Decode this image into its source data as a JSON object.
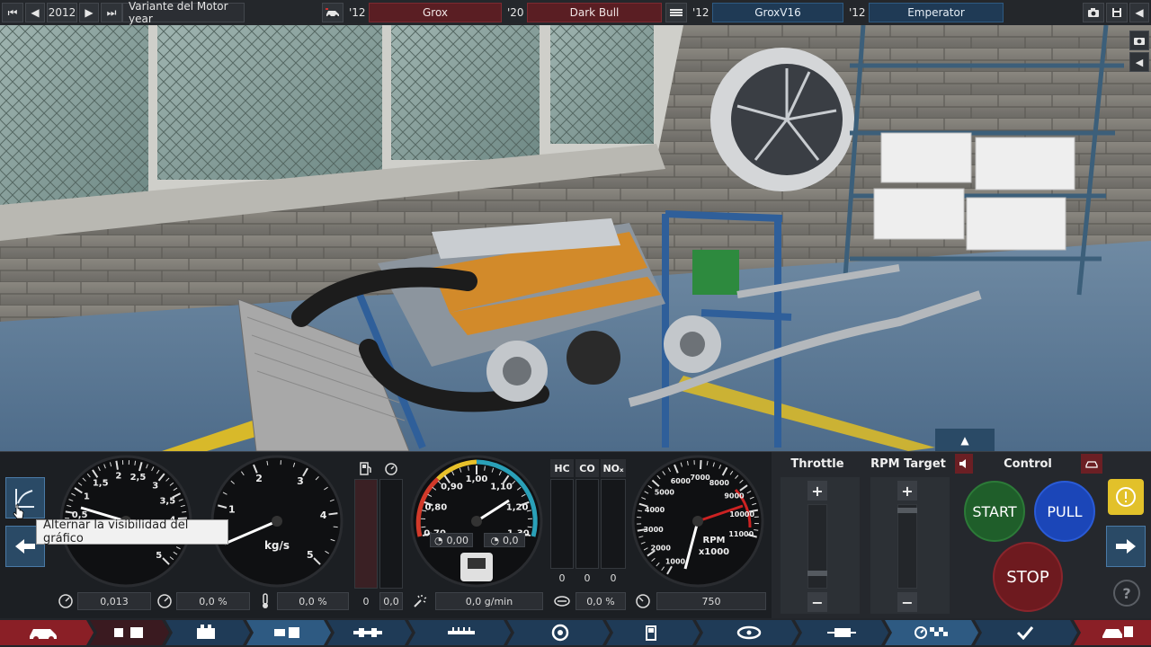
{
  "topbar": {
    "year": "2012",
    "variant_label": "Variante del Motor year",
    "slots": [
      {
        "year": "'12",
        "name": "Grox"
      },
      {
        "year": "'20",
        "name": "Dark Bull"
      },
      {
        "year": "'12",
        "name": "GroxV16"
      },
      {
        "year": "'12",
        "name": "Emperator"
      }
    ]
  },
  "gauges": {
    "boost": {
      "ticks": [
        "0",
        "0,5",
        "1",
        "1,5",
        "2",
        "2,5",
        "3",
        "3,5",
        "4",
        "4,5",
        "5"
      ],
      "readout": "0,013"
    },
    "airflow": {
      "ticks": [
        "1",
        "2",
        "3",
        "4",
        "5"
      ],
      "unit": "kg/s",
      "readout": "0,0 %"
    },
    "temp_readout": "0,0 %",
    "fuel_bars": {
      "value_left": "0",
      "value_right": "0,0"
    },
    "afr": {
      "ticks": [
        "0,70",
        "0,80",
        "0,90",
        "1,00",
        "1,10",
        "1,20",
        "1,30"
      ],
      "sub_left": "0,00",
      "sub_right": "0,0",
      "readout": "0,0 g/min"
    },
    "emissions": {
      "labels": [
        "HC",
        "CO",
        "NOₓ"
      ],
      "values": [
        "0",
        "0",
        "0"
      ],
      "readout": "0,0 %"
    },
    "rpm": {
      "ticks": [
        "1000",
        "2000",
        "3000",
        "4000",
        "5000",
        "6000",
        "7000",
        "8000",
        "9000",
        "10000",
        "11000"
      ],
      "unit_top": "RPM",
      "unit_bottom": "x1000",
      "readout": "750"
    }
  },
  "controls": {
    "throttle_label": "Throttle",
    "rpm_target_label": "RPM Target",
    "control_label": "Control",
    "plus": "+",
    "minus": "−",
    "start": "START",
    "pull": "PULL",
    "stop": "STOP"
  },
  "tooltip": "Alternar la visibilidad del gráfico",
  "colors": {
    "accent_blue": "#2e5a82",
    "slot_red": "#5a1e23",
    "start_green": "#1f5e2a",
    "pull_blue": "#1b46b8",
    "stop_red": "#6e1a1f",
    "warning_yellow": "#e2c12a"
  }
}
